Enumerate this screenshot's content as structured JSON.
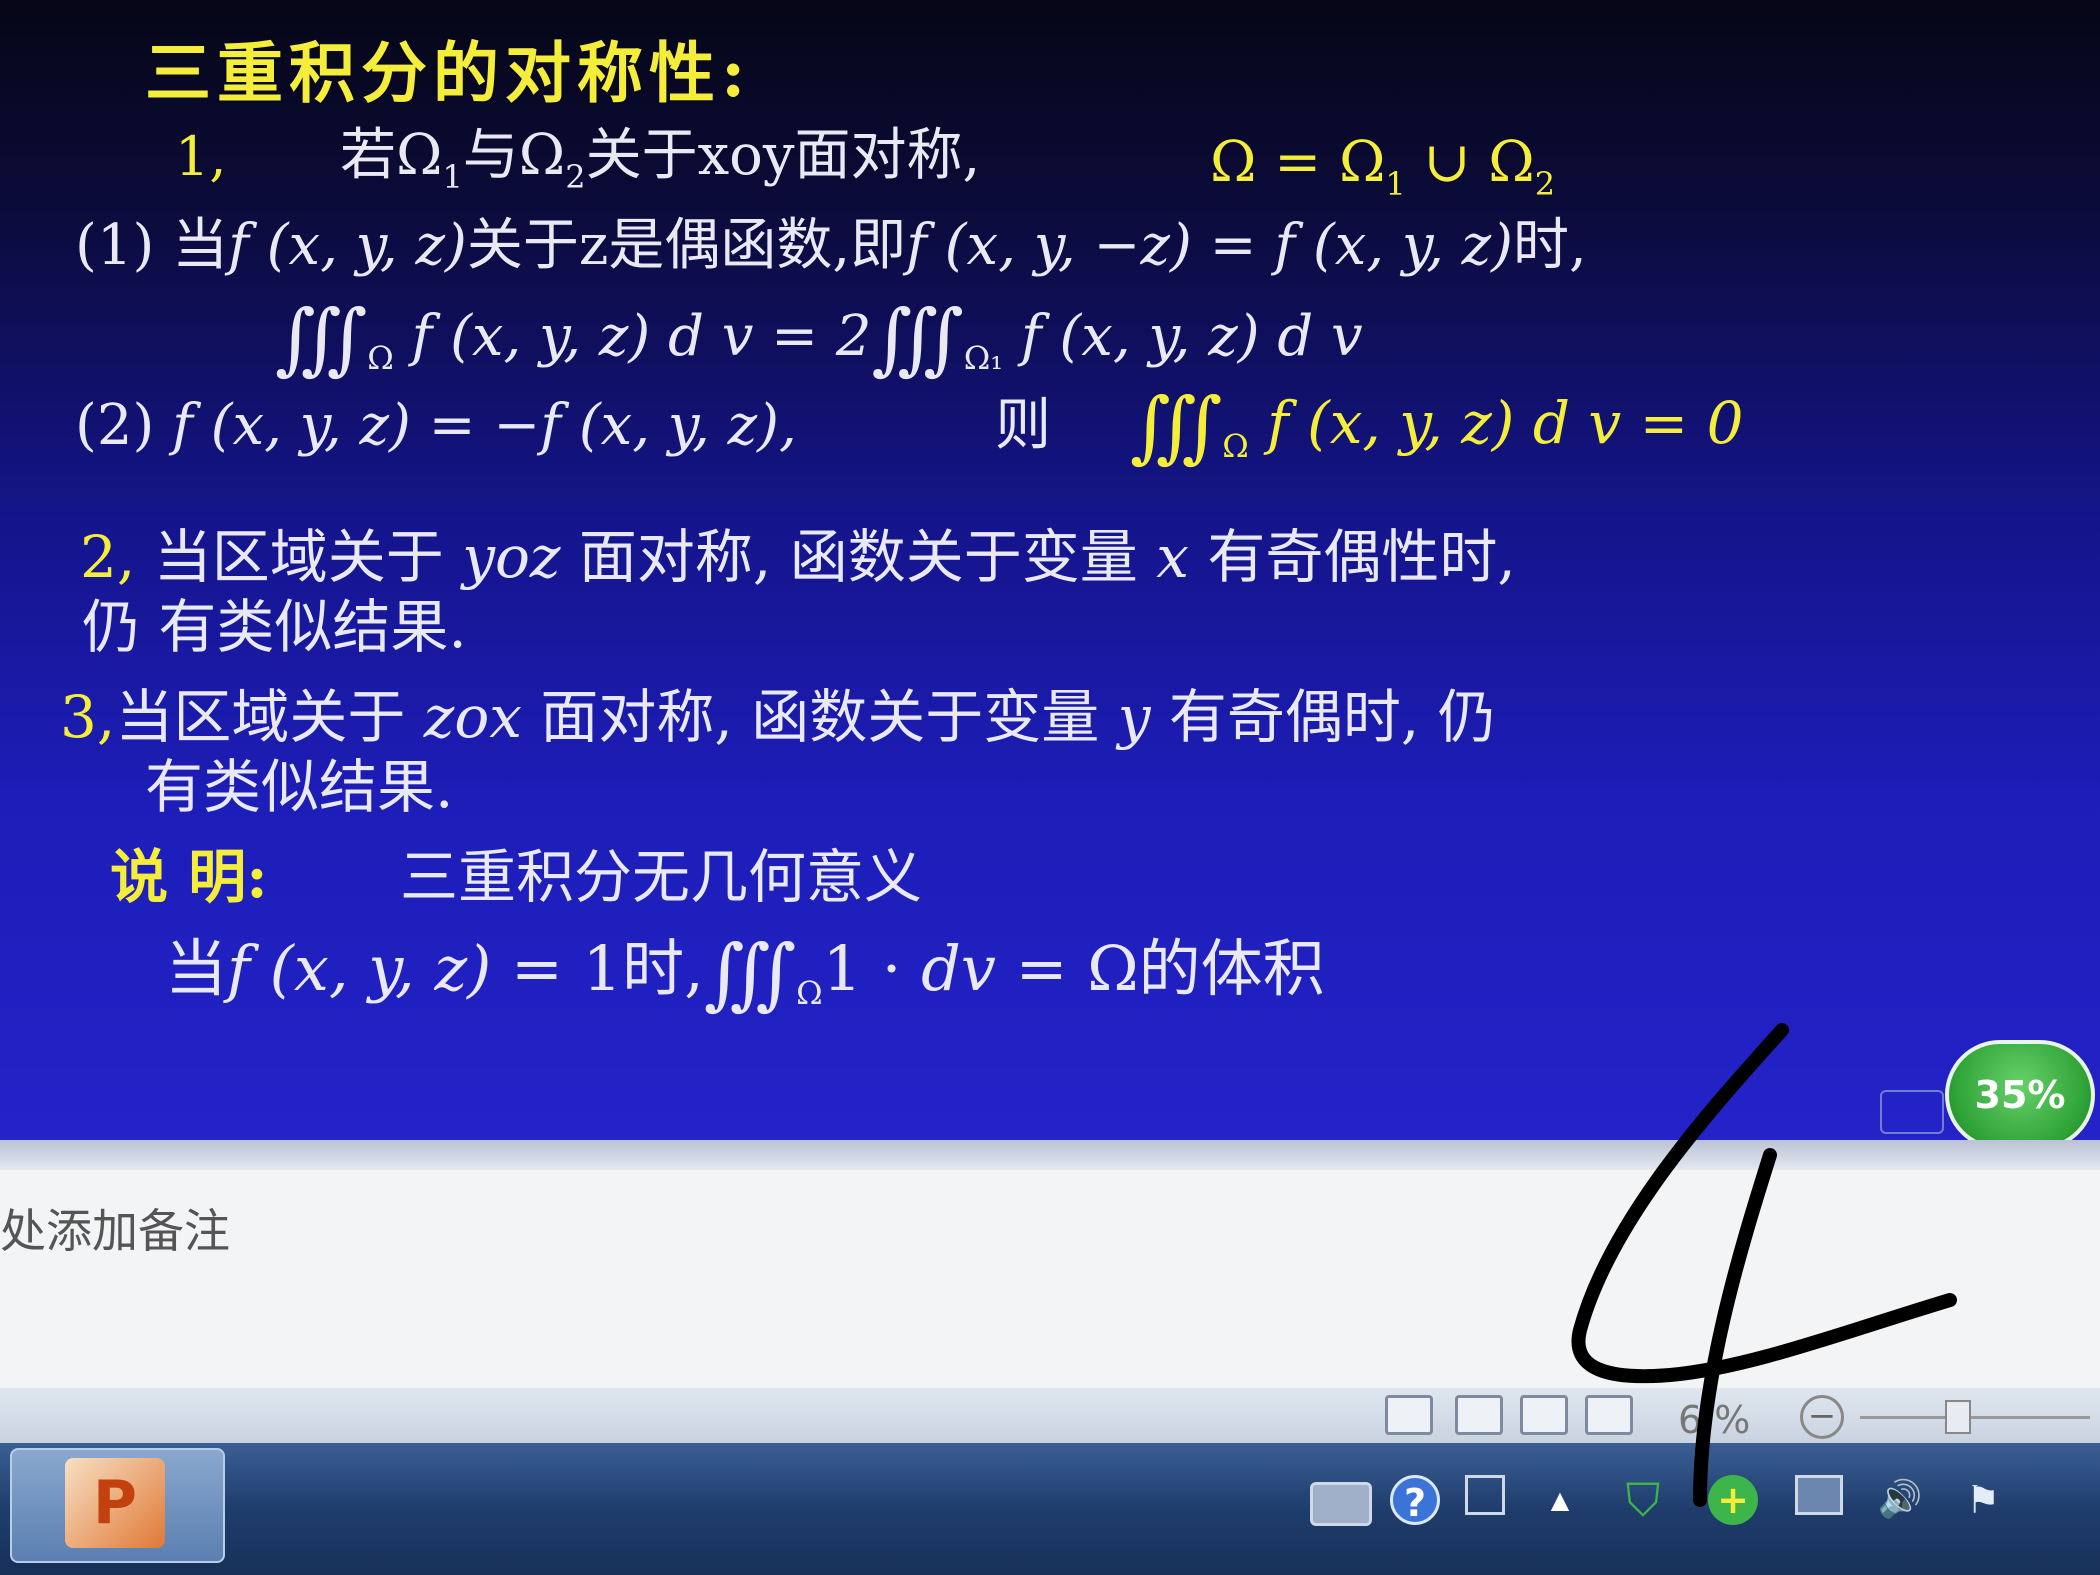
{
  "slide": {
    "title": "三重积分的对称性:",
    "item1": {
      "num": "1,",
      "text": "若Ω",
      "sub1": "1",
      "mid": "与Ω",
      "sub2": "2",
      "rest": "关于xoy面对称,",
      "formula": "Ω = Ω",
      "fsub1": "1",
      "cup": " ∪ Ω",
      "fsub2": "2"
    },
    "case1": {
      "label": "(1) 当",
      "fn": "f (x, y, z)",
      "cond": "关于z是偶函数,即",
      "eq": "f (x, y, −z) = f (x, y, z)",
      "end": "时,"
    },
    "case1_formula": {
      "lhs_int": "∭",
      "lhs_sub": "Ω",
      "lhs": " f (x, y, z) d v = 2",
      "rhs_int": "∭",
      "rhs_sub": "Ω₁",
      "rhs": " f (x, y, z) d v"
    },
    "case2": {
      "label": "(2)",
      "eq": " f (x, y, z) = −f (x, y, z),",
      "then": "则",
      "int": "∭",
      "int_sub": "Ω",
      "result": " f (x, y, z) d v = 0"
    },
    "item2": {
      "num": "2,",
      "line1a": " 当区域关于 ",
      "var": "yoz",
      "line1b": " 面对称, 函数关于变量 ",
      "var2": "x",
      "line1c": " 有奇偶性时,",
      "line2": "仍 有类似结果."
    },
    "item3": {
      "num": "3,",
      "line1a": "当区域关于 ",
      "var": "zox",
      "line1b": " 面对称, 函数关于变量 ",
      "var2": "y",
      "line1c": " 有奇偶时, 仍",
      "line2": "有类似结果."
    },
    "note": {
      "label": "说 明:",
      "text": "三重积分无几何意义"
    },
    "volume": {
      "prefix": "当",
      "fn": "f (x, y, z)",
      "eq1": " = 1时,",
      "int": "∭",
      "int_sub": "Ω",
      "rest": "1 · ",
      "dv": "dv",
      "end": " = Ω的体积"
    }
  },
  "badge": "35%",
  "notes_placeholder": "处添加备注",
  "statusbar": {
    "zoom": "6 %",
    "zoom_minus": "−"
  },
  "taskbar": {
    "ppt_icon_label": "P",
    "help_icon": "?",
    "tray_up_arrow": "▲",
    "shield_icon": "⛉",
    "plus_icon": "+",
    "volume_icon": "🔊",
    "flag_icon": "⚑"
  },
  "handwritten_number": "4",
  "colors": {
    "highlight": "#f4ee3a",
    "text": "#e9e9f4",
    "slide_bg": "#1d1db8",
    "badge_green": "#2fa337"
  }
}
